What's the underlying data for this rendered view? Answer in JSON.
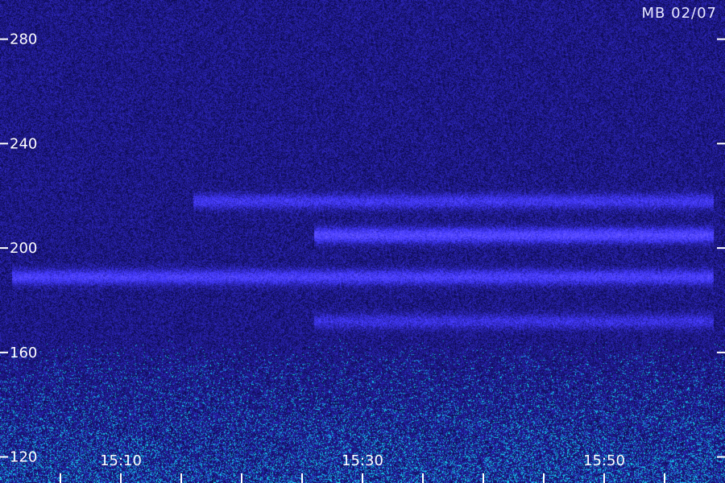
{
  "stamp": "MB 02/07",
  "chart_data": {
    "type": "heatmap",
    "title": "",
    "xlabel": "",
    "ylabel": "",
    "x_range": [
      "15:00",
      "15:59"
    ],
    "y_range": [
      110,
      295
    ],
    "y_ticks": [
      120,
      160,
      200,
      240,
      280
    ],
    "x_ticks": [
      "15:10",
      "15:30",
      "15:50"
    ],
    "x_minor_ticks": [
      "15:05",
      "15:15",
      "15:20",
      "15:25",
      "15:35",
      "15:40",
      "15:45",
      "15:55"
    ],
    "bands": [
      {
        "y": 218,
        "start": "15:16",
        "end": "15:59",
        "intensity": 0.55
      },
      {
        "y": 205,
        "start": "15:26",
        "end": "15:59",
        "intensity": 0.85
      },
      {
        "y": 189,
        "start": "15:01",
        "end": "15:59",
        "intensity": 0.7
      },
      {
        "y": 172,
        "start": "15:26",
        "end": "15:59",
        "intensity": 0.45
      }
    ],
    "colors": {
      "background": "#14107a",
      "signal": "#5c6cff",
      "strong": "#c8d0ff",
      "noise_floor": "#00e0ff"
    }
  }
}
